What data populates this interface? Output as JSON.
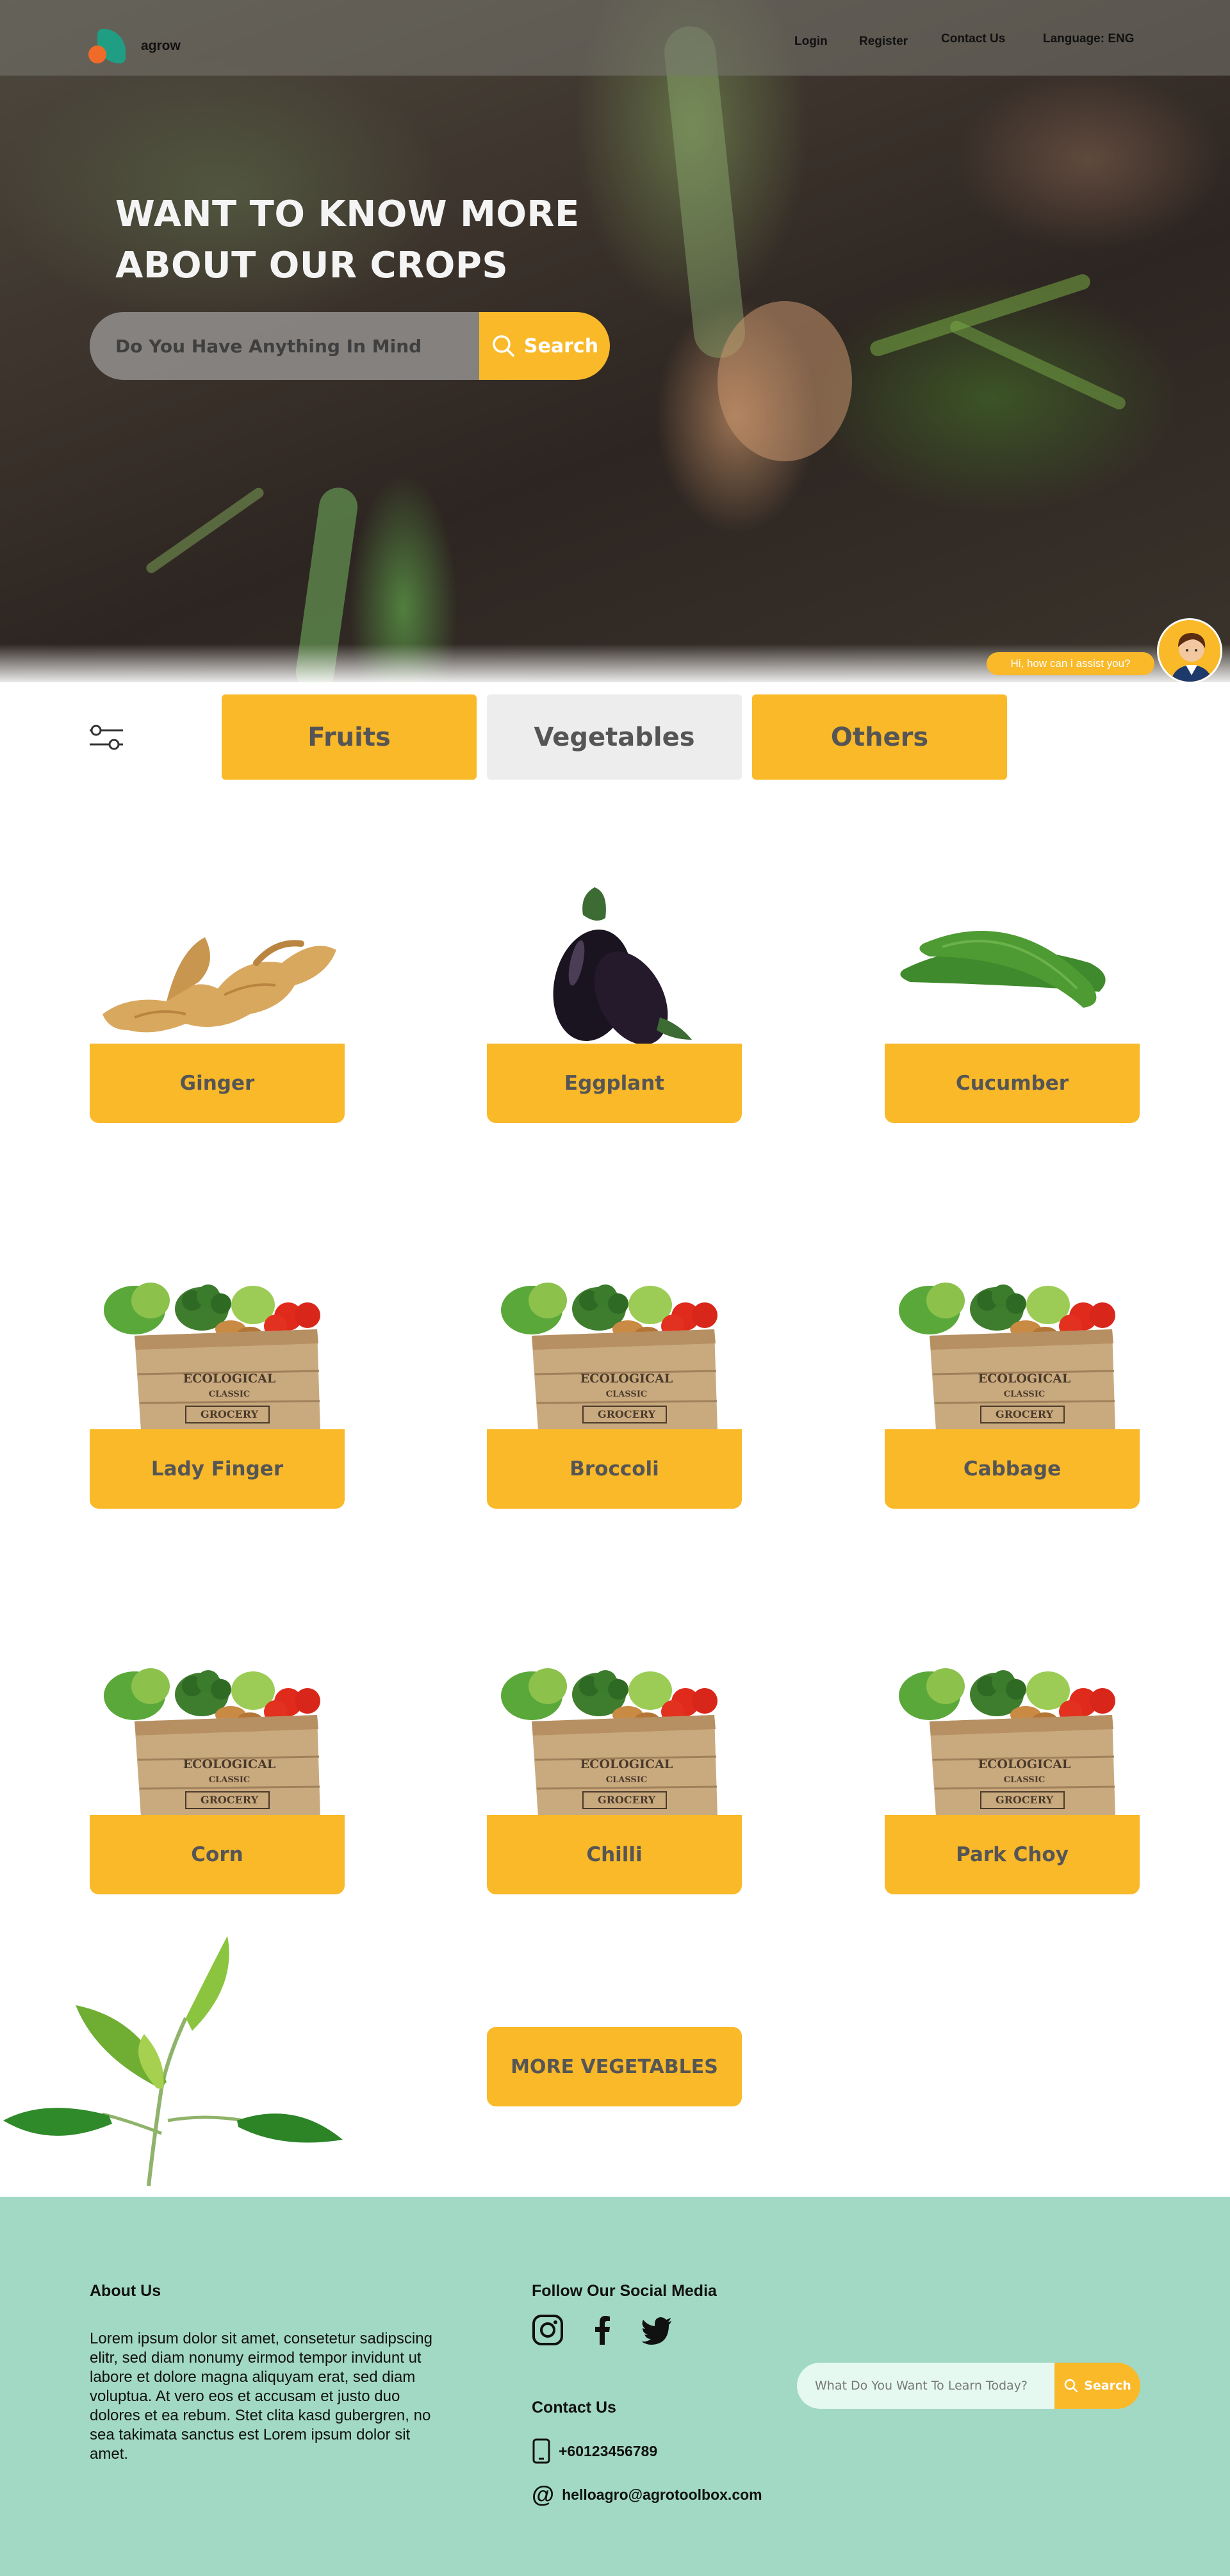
{
  "header": {
    "brand": "agrow",
    "nav": {
      "login": "Login",
      "register": "Register",
      "contact": "Contact Us",
      "language": "Language: ENG"
    }
  },
  "hero": {
    "title_line1": "WANT TO KNOW MORE",
    "title_line2": "ABOUT OUR CROPS",
    "search_placeholder": "Do You Have Anything In Mind",
    "search_button": "Search"
  },
  "assistant": {
    "bubble_text": "Hi, how can i assist you?"
  },
  "categories": {
    "tabs": [
      "Fruits",
      "Vegetables",
      "Others"
    ],
    "active": "Vegetables"
  },
  "products": [
    {
      "name": "Ginger",
      "image": "ginger"
    },
    {
      "name": "Eggplant",
      "image": "eggplant"
    },
    {
      "name": "Cucumber",
      "image": "cucumber"
    },
    {
      "name": "Lady Finger",
      "image": "vegetable-crate"
    },
    {
      "name": "Broccoli",
      "image": "vegetable-crate"
    },
    {
      "name": "Cabbage",
      "image": "vegetable-crate"
    },
    {
      "name": "Corn",
      "image": "vegetable-crate"
    },
    {
      "name": "Chilli",
      "image": "vegetable-crate"
    },
    {
      "name": "Park Choy",
      "image": "vegetable-crate"
    }
  ],
  "crate_labels": [
    "ECOLOGICAL",
    "CLASSIC",
    "GROCERY"
  ],
  "more_button": "MORE VEGETABLES",
  "footer": {
    "about_title": "About Us",
    "about_text": "Lorem ipsum dolor sit amet, consetetur sadipscing elitr, sed diam nonumy eirmod tempor invidunt ut labore et dolore magna aliquyam erat, sed diam voluptua. At vero eos et accusam et justo duo dolores et ea rebum. Stet clita kasd gubergren, no sea takimata sanctus est Lorem ipsum dolor sit amet.",
    "social_title": "Follow Our Social Media",
    "social_icons": [
      "instagram-icon",
      "facebook-icon",
      "twitter-icon"
    ],
    "contact_title": "Contact Us",
    "phone": "+60123456789",
    "email": "helloagro@agrotoolbox.com",
    "search_placeholder": "What Do You Want To Learn Today?",
    "search_button": "Search"
  },
  "colors": {
    "accent": "#f9b929",
    "footer_bg": "#a2d9c4",
    "tab_inactive": "#ededed",
    "logo_green": "#1f9e84",
    "logo_orange": "#f06b2a"
  }
}
